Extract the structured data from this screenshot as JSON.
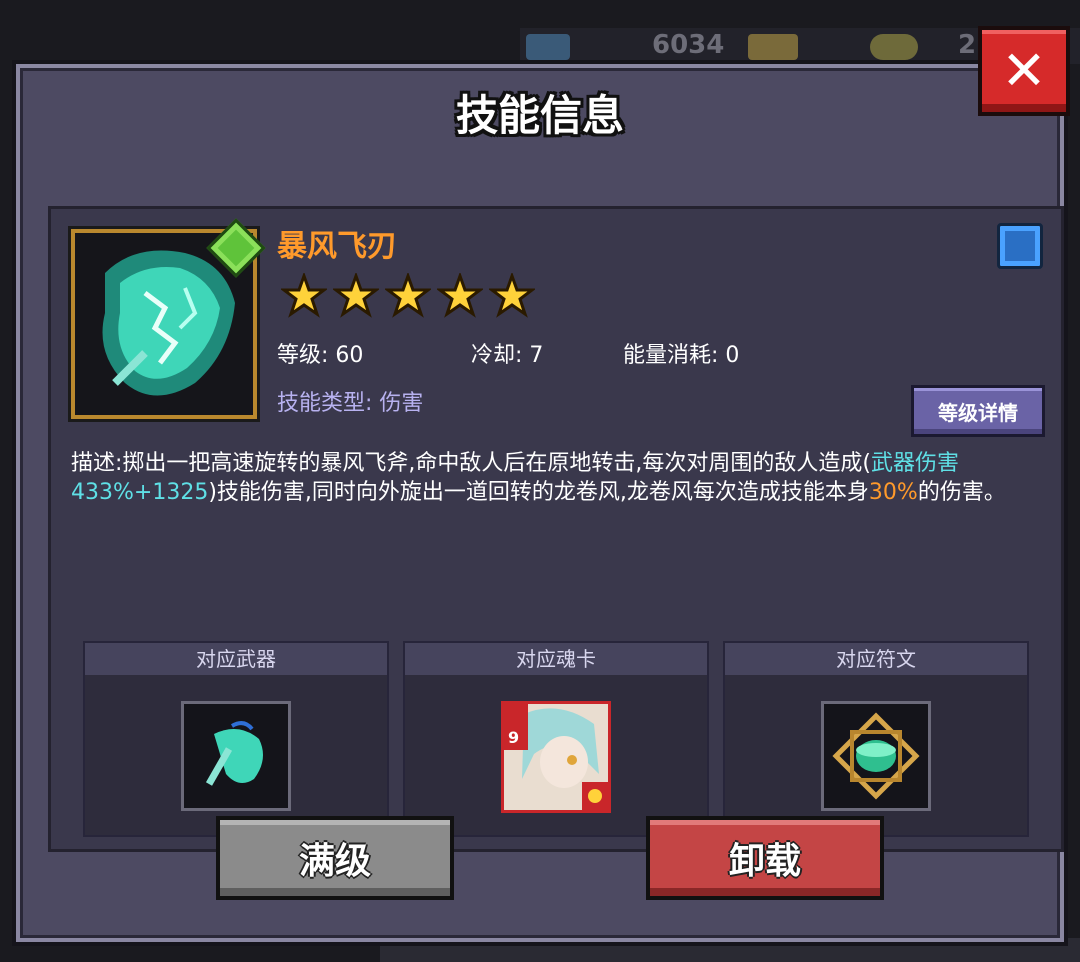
{
  "background": {
    "resource_value": "6034",
    "other_value": "2"
  },
  "dialog": {
    "title": "技能信息",
    "close_label": "✕"
  },
  "skill": {
    "name": "暴风飞刃",
    "stars": 5,
    "level_label": "等级:",
    "level": "60",
    "cooldown_label": "冷却:",
    "cooldown": "7",
    "energy_label": "能量消耗:",
    "energy": "0",
    "type_label": "技能类型:",
    "type": "伤害",
    "detail_button": "等级详情",
    "description": {
      "part1": "描述:掷出一把高速旋转的暴风飞斧,命中敌人后在原地转击,每次对周围的敌人造成(",
      "highlight1": "武器伤害433%+1325",
      "part2": ")技能伤害,同时向外旋出一道回转的龙卷风,龙卷风每次造成技能本身",
      "highlight2": "30%",
      "part3": "的伤害。"
    }
  },
  "slots": {
    "weapon": "对应武器",
    "soul_card": "对应魂卡",
    "rune": "对应符文",
    "card_level": "9"
  },
  "buttons": {
    "max_level": "满级",
    "unload": "卸载"
  },
  "colors": {
    "accent_orange": "#ff9a2b",
    "accent_cyan": "#5fe0e6",
    "panel": "#4d4a62",
    "close_red": "#d62a2a"
  }
}
